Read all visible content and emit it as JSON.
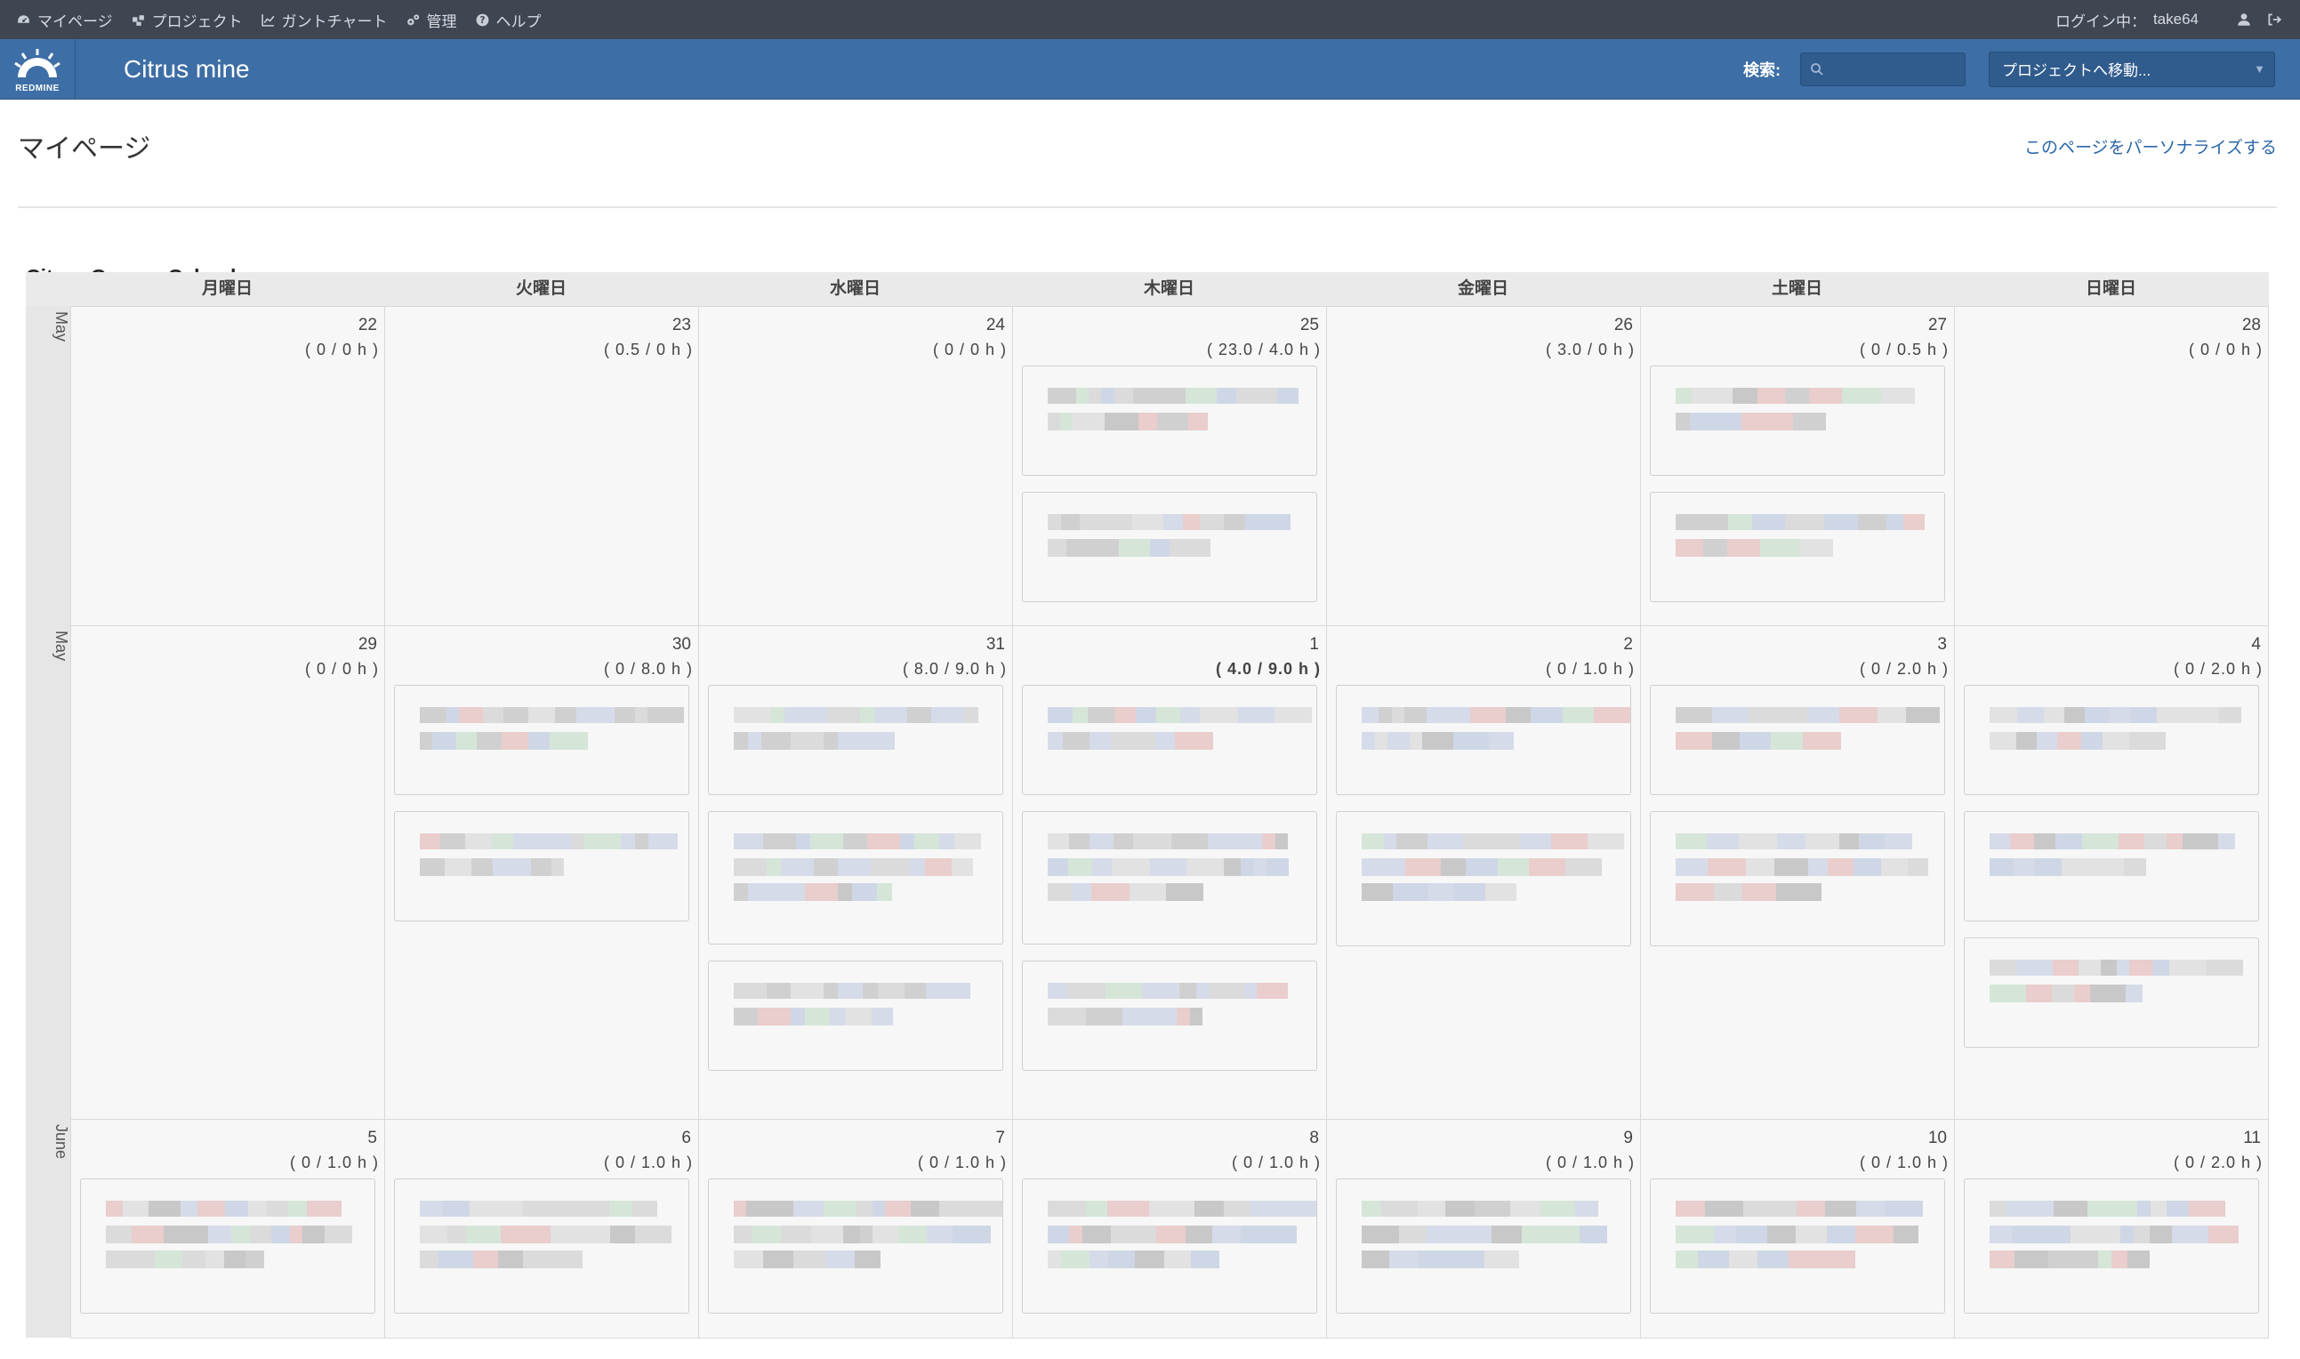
{
  "top_menu": {
    "items": [
      {
        "label": "マイページ",
        "icon": "dashboard-icon"
      },
      {
        "label": "プロジェクト",
        "icon": "projects-icon"
      },
      {
        "label": "ガントチャート",
        "icon": "chart-icon"
      },
      {
        "label": "管理",
        "icon": "gears-icon"
      },
      {
        "label": "ヘルプ",
        "icon": "help-icon"
      }
    ],
    "login_prefix": "ログイン中：",
    "user": "take64"
  },
  "header": {
    "logo_text": "REDMINE",
    "site_title": "Citrus mine",
    "search_label": "検索:",
    "search_value": "",
    "project_jump": "プロジェクトへ移動..."
  },
  "page": {
    "title": "マイページ",
    "personalize": "このページをパーソナライズする",
    "calendar_title": "Citrus Groove Calendar"
  },
  "calendar": {
    "days_of_week": [
      "月曜日",
      "火曜日",
      "水曜日",
      "木曜日",
      "金曜日",
      "土曜日",
      "日曜日"
    ],
    "weeks": [
      {
        "month": "May",
        "days": [
          {
            "day": "22",
            "hours": "( 0 / 0 h )",
            "cards": 0
          },
          {
            "day": "23",
            "hours": "( 0.5 / 0 h )",
            "cards": 0
          },
          {
            "day": "24",
            "hours": "( 0 / 0 h )",
            "cards": 0
          },
          {
            "day": "25",
            "hours": "( 23.0 / 4.0 h )",
            "cards": 2
          },
          {
            "day": "26",
            "hours": "( 3.0 / 0 h )",
            "cards": 0
          },
          {
            "day": "27",
            "hours": "( 0 / 0.5 h )",
            "cards": 2
          },
          {
            "day": "28",
            "hours": "( 0 / 0 h )",
            "cards": 0
          }
        ]
      },
      {
        "month": "May",
        "days": [
          {
            "day": "29",
            "hours": "( 0 / 0 h )",
            "cards": 0
          },
          {
            "day": "30",
            "hours": "( 0 / 8.0 h )",
            "cards": 2
          },
          {
            "day": "31",
            "hours": "( 8.0 / 9.0 h )",
            "cards": 3
          },
          {
            "day": "1",
            "hours": "( 4.0 / 9.0 h )",
            "cards": 3,
            "bold": true
          },
          {
            "day": "2",
            "hours": "( 0 / 1.0 h )",
            "cards": 2
          },
          {
            "day": "3",
            "hours": "( 0 / 2.0 h )",
            "cards": 2
          },
          {
            "day": "4",
            "hours": "( 0 / 2.0 h )",
            "cards": 3
          }
        ]
      },
      {
        "month": "June",
        "days": [
          {
            "day": "5",
            "hours": "( 0 / 1.0 h )",
            "cards": 1
          },
          {
            "day": "6",
            "hours": "( 0 / 1.0 h )",
            "cards": 1
          },
          {
            "day": "7",
            "hours": "( 0 / 1.0 h )",
            "cards": 1
          },
          {
            "day": "8",
            "hours": "( 0 / 1.0 h )",
            "cards": 1
          },
          {
            "day": "9",
            "hours": "( 0 / 1.0 h )",
            "cards": 1
          },
          {
            "day": "10",
            "hours": "( 0 / 1.0 h )",
            "cards": 1
          },
          {
            "day": "11",
            "hours": "( 0 / 2.0 h )",
            "cards": 1
          }
        ]
      }
    ]
  },
  "colors": {
    "top_menu_bg": "#3f4551",
    "header_bg": "#3d6ea6",
    "link": "#2b67a8",
    "cell_bg": "#f7f7f7"
  }
}
